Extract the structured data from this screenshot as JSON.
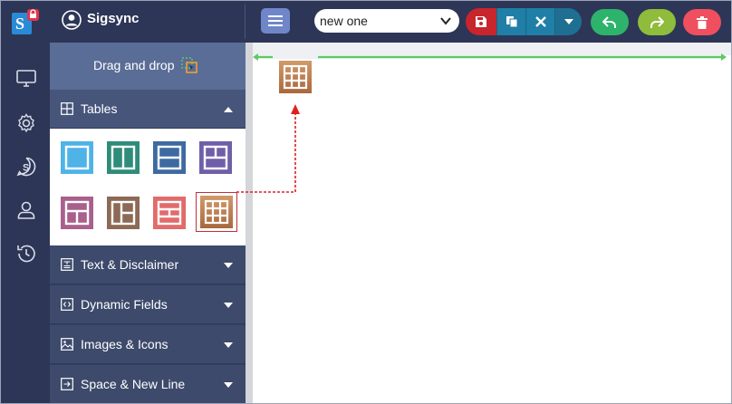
{
  "app": {
    "name": "Sigsync"
  },
  "header": {
    "signature_name": "new one",
    "icons": {
      "logo": "sigsync-logo-icon",
      "profile": "user-circle-icon",
      "menu": "hamburger-icon",
      "save": "save-icon",
      "copy": "copy-icon",
      "close": "close-icon",
      "dropdown": "caret-down-icon",
      "undo": "undo-icon",
      "redo": "redo-icon",
      "delete": "trash-icon"
    }
  },
  "rail": {
    "icons": [
      "monitor-icon",
      "gear-icon",
      "sigsync-s-icon",
      "user-icon",
      "history-icon"
    ]
  },
  "panel": {
    "drag_and_drop": "Drag and drop",
    "sections": [
      {
        "label": "Tables",
        "icon": "table-icon",
        "state": "expanded"
      },
      {
        "label": "Text & Disclaimer",
        "icon": "text-icon",
        "state": "collapsed"
      },
      {
        "label": "Dynamic Fields",
        "icon": "code-icon",
        "state": "collapsed"
      },
      {
        "label": "Images & Icons",
        "icon": "image-icon",
        "state": "collapsed"
      },
      {
        "label": "Space & New Line",
        "icon": "newline-icon",
        "state": "collapsed"
      }
    ],
    "table_layouts": [
      {
        "layout": "single-cell",
        "color": "#4fb3e8"
      },
      {
        "layout": "two-columns",
        "color": "#2f8c7a"
      },
      {
        "layout": "two-rows",
        "color": "#3e6aa1"
      },
      {
        "layout": "top-row-two-bottom",
        "color": "#6f5fa8"
      },
      {
        "layout": "two-top-one-bottom",
        "color": "#a9608c"
      },
      {
        "layout": "left-column-right-split",
        "color": "#8c6a55"
      },
      {
        "layout": "three-rows-split",
        "color": "#e16b6b"
      },
      {
        "layout": "grid-3x3",
        "color": "#b9784a",
        "selected": true
      }
    ]
  },
  "colors": {
    "topbar": "#2d3656",
    "panel": "#34405f",
    "accent_green_line": "#5ec86a",
    "drag_arrow": "#e02020"
  }
}
